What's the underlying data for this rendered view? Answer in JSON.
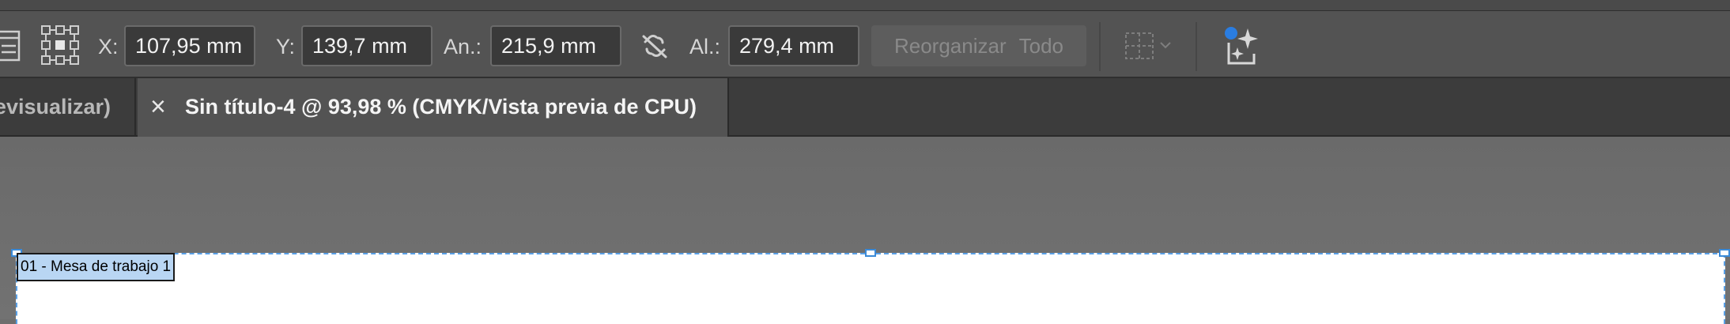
{
  "controlbar": {
    "x_label": "X:",
    "x_value": "107,95 mm",
    "y_label": "Y:",
    "y_value": "139,7 mm",
    "w_label": "An.:",
    "w_value": "215,9 mm",
    "h_label": "Al.:",
    "h_value": "279,4 mm",
    "rearrange_label": "Reorganizar",
    "all_label": "Todo"
  },
  "tabs": [
    {
      "label": "evisualizar)"
    },
    {
      "label": "Sin título-4 @ 93,98 % (CMYK/Vista previa de CPU)",
      "close_glyph": "×"
    }
  ],
  "artboard": {
    "label": "01 - Mesa de trabajo 1"
  },
  "colors": {
    "accent_blue": "#2a7de1",
    "selection_blue": "#5aa0e6",
    "label_highlight": "#b9d6f3"
  },
  "icons": {
    "doc_setup": "doc-setup-icon",
    "reference_point": "reference-point-icon",
    "link_proportions": "unlink-proportions-icon",
    "align_select": "align-select-icon",
    "generative_expand": "generative-expand-icon"
  }
}
